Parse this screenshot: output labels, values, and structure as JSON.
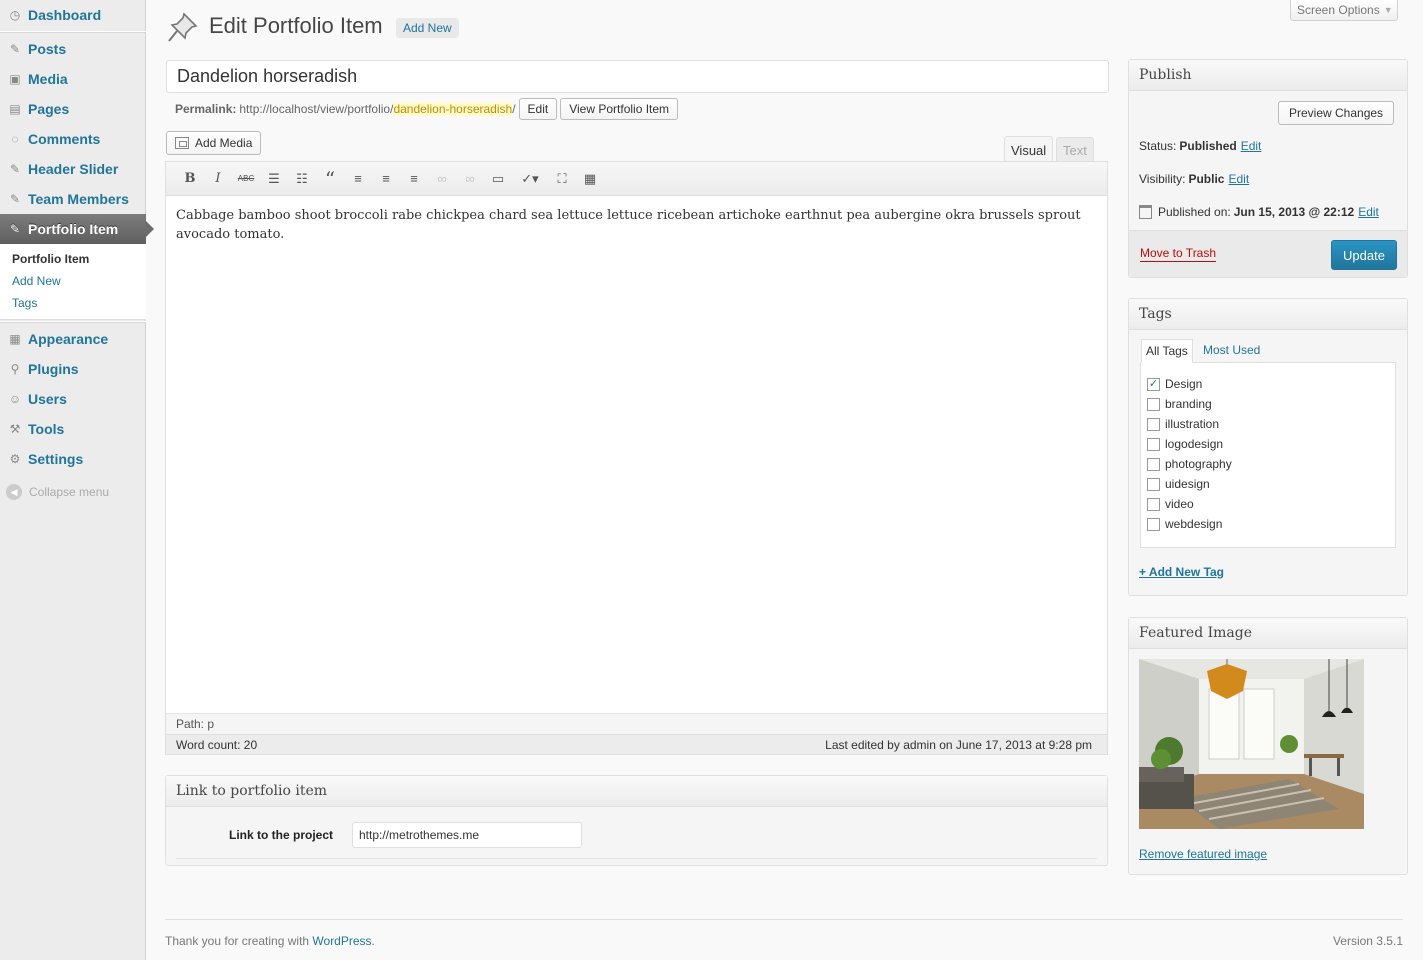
{
  "sidebar": {
    "dashboard": "Dashboard",
    "posts": "Posts",
    "media": "Media",
    "pages": "Pages",
    "comments": "Comments",
    "header_slider": "Header Slider",
    "team_members": "Team Members",
    "portfolio_item": "Portfolio Item",
    "submenu": {
      "portfolio_item": "Portfolio Item",
      "add_new": "Add New",
      "tags": "Tags"
    },
    "appearance": "Appearance",
    "plugins": "Plugins",
    "users": "Users",
    "tools": "Tools",
    "settings": "Settings",
    "collapse": "Collapse menu"
  },
  "header": {
    "screen_options": "Screen Options",
    "title": "Edit Portfolio Item",
    "add_new": "Add New"
  },
  "post": {
    "title": "Dandelion horseradish",
    "permalink_label": "Permalink:",
    "permalink_base": "http://localhost/view/portfolio/",
    "permalink_slug": "dandelion-horseradish",
    "permalink_trail": "/",
    "edit_label": "Edit",
    "view_label": "View Portfolio Item"
  },
  "editor": {
    "add_media": "Add Media",
    "tab_visual": "Visual",
    "tab_text": "Text",
    "content": "Cabbage bamboo shoot broccoli rabe chickpea chard sea lettuce lettuce ricebean artichoke earthnut pea aubergine okra brussels sprout avocado tomato.",
    "path": "Path: p",
    "word_count": "Word count: 20",
    "last_edited": "Last edited by admin on June 17, 2013 at 9:28 pm",
    "toolbar": {
      "bold": "B",
      "italic": "I",
      "strike": "ABC",
      "quote": "“"
    }
  },
  "link_box": {
    "heading": "Link to portfolio item",
    "label": "Link to the project",
    "value": "http://metrothemes.me"
  },
  "publish": {
    "heading": "Publish",
    "preview": "Preview Changes",
    "status_label": "Status:",
    "status_value": "Published",
    "visibility_label": "Visibility:",
    "visibility_value": "Public",
    "published_label": "Published on:",
    "published_value": "Jun 15, 2013 @ 22:12",
    "edit": "Edit",
    "trash": "Move to Trash",
    "update": "Update"
  },
  "tags": {
    "heading": "Tags",
    "tab_all": "All Tags",
    "tab_most": "Most Used",
    "items": [
      {
        "label": "Design",
        "checked": true
      },
      {
        "label": "branding",
        "checked": false
      },
      {
        "label": "illustration",
        "checked": false
      },
      {
        "label": "logodesign",
        "checked": false
      },
      {
        "label": "photography",
        "checked": false
      },
      {
        "label": "uidesign",
        "checked": false
      },
      {
        "label": "video",
        "checked": false
      },
      {
        "label": "webdesign",
        "checked": false
      }
    ],
    "add_new": "+ Add New Tag"
  },
  "featured": {
    "heading": "Featured Image",
    "remove": "Remove featured image"
  },
  "footer": {
    "thanks": "Thank you for creating with ",
    "wp": "WordPress",
    "period": ".",
    "version": "Version 3.5.1"
  },
  "colors": {
    "link": "#21759b",
    "primary_button": "#21759b",
    "trash": "#bc0b0b",
    "slug_highlight": "#fffbcc"
  }
}
